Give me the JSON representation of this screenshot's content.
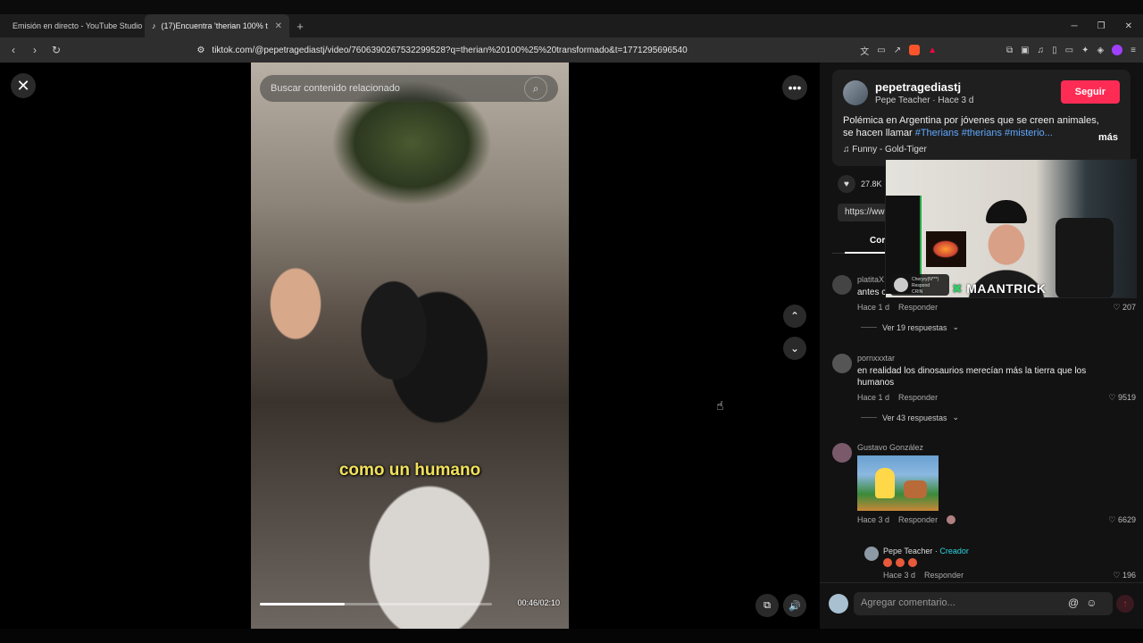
{
  "browser": {
    "tabs": [
      {
        "title": "Emisión en directo - YouTube Studio",
        "icon_color": "#ff0000"
      },
      {
        "title": "(17)Encuentra 'therian 100% t",
        "icon_color": "#ffffff"
      }
    ],
    "url": "tiktok.com/@pepetragediastj/video/7606390267532299528?q=therian%20100%25%20transformado&t=1771295696540"
  },
  "video": {
    "search_placeholder": "Buscar contenido relacionado",
    "caption": "como un humano",
    "progress_fraction": 0.365,
    "time": "00:46/02:10"
  },
  "author": {
    "username": "pepetragediastj",
    "subtitle": "Pepe Teacher · Hace 3 d",
    "follow_label": "Seguir",
    "desc_text": "Polémica en Argentina por jóvenes que se creen animales, se hacen llamar ",
    "tags": [
      "#Therians",
      "#therians",
      "#misterio..."
    ],
    "more_label": "más",
    "music": "Funny - Gold-Tiger"
  },
  "stats": {
    "likes": "27.8K",
    "link": "https://ww"
  },
  "comments_tab": {
    "label": "Cor"
  },
  "overlay": {
    "brand": "MAANTRICK",
    "notif_line1": "Cheryry(N***)",
    "notif_line2": "Respond",
    "notif_line3": "CRIN"
  },
  "comments": [
    {
      "user": "platitaX",
      "text": "antes c",
      "time": "Hace 1 d",
      "reply_label": "Responder",
      "likes": "207",
      "replies": "Ver 19 respuestas"
    },
    {
      "user": "pornxxxtar",
      "text": "en realidad los dinosaurios merecían más la tierra que los humanos",
      "time": "Hace 1 d",
      "reply_label": "Responder",
      "likes": "9519",
      "replies": "Ver 43 respuestas"
    },
    {
      "user": "Gustavo González",
      "text": "",
      "time": "Hace 3 d",
      "reply_label": "Responder",
      "likes": "6629"
    }
  ],
  "reply": {
    "user": "Pepe Teacher",
    "creator_label": "Creador",
    "time": "Hace 3 d",
    "reply_label": "Responder",
    "likes": "196"
  },
  "input": {
    "placeholder": "Agregar comentario..."
  }
}
